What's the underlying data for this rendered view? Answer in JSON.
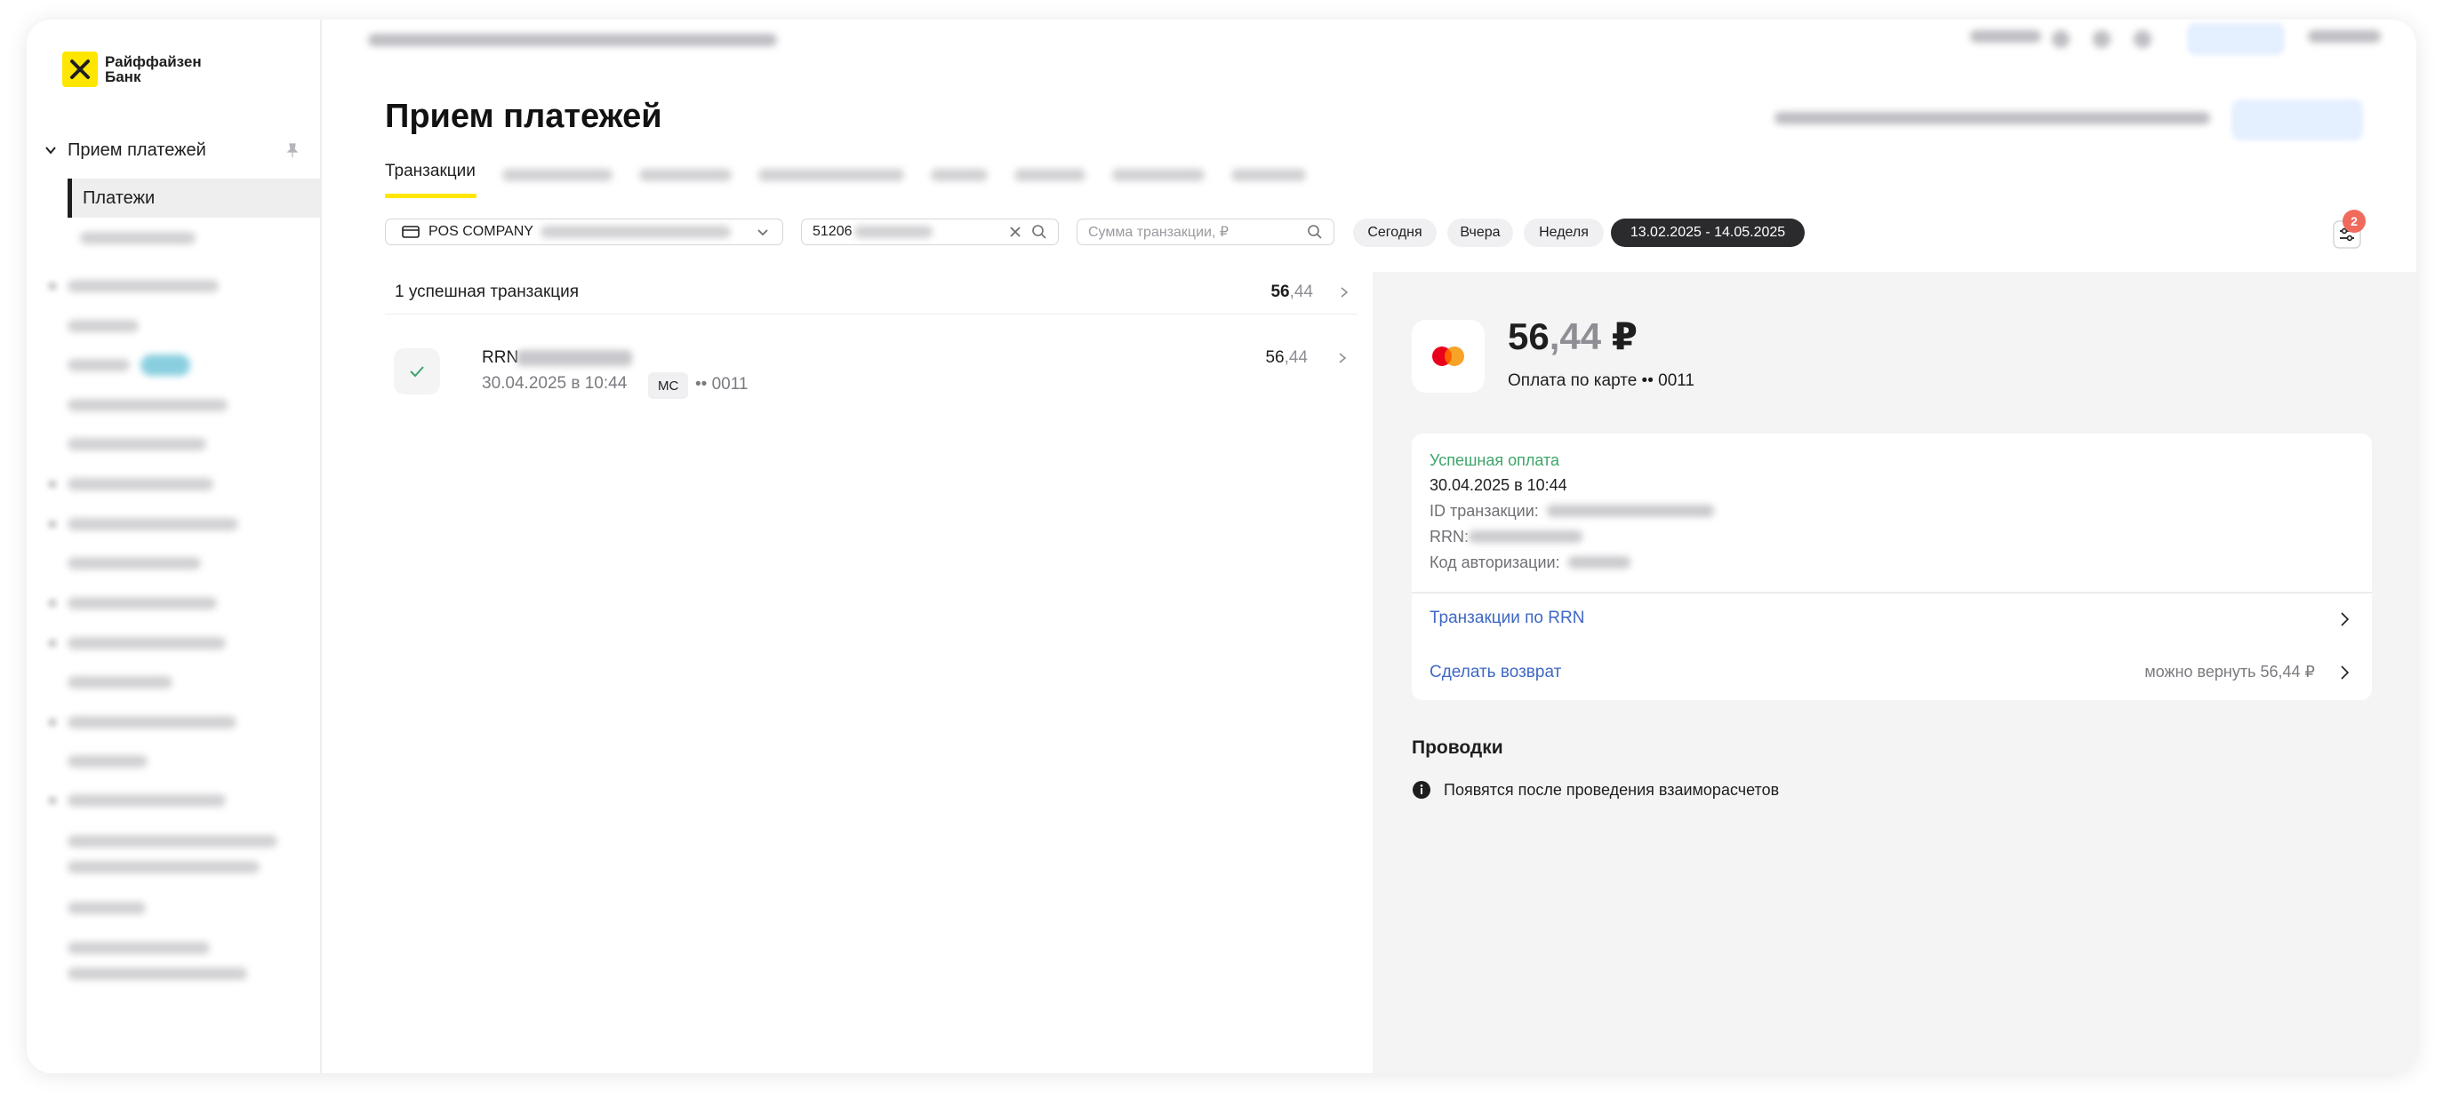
{
  "logo": {
    "line1": "Райффайзен",
    "line2": "Банк"
  },
  "sidebar": {
    "section_label": "Прием платежей",
    "active_item": "Платежи"
  },
  "page": {
    "title": "Прием платежей"
  },
  "tabs": {
    "active": "Транзакции"
  },
  "filters": {
    "terminal": "POS COMPANY",
    "search_value": "51206",
    "amount_placeholder": "Сумма транзакции, ₽"
  },
  "period_chips": {
    "today": "Сегодня",
    "yesterday": "Вчера",
    "week": "Неделя",
    "range": "13.02.2025 - 14.05.2025"
  },
  "settings_badge": "2",
  "summary": {
    "label": "1 успешная транзакция",
    "amount_int": "56",
    "amount_frac": ",44"
  },
  "transaction": {
    "rrn_label": "RRN",
    "date": "30.04.2025 в 10:44",
    "card_type": "MC",
    "card_mask": "•• 0011",
    "amount_int": "56",
    "amount_frac": ",44"
  },
  "detail": {
    "amount_int": "56",
    "amount_frac": ",44",
    "currency": "₽",
    "description": "Оплата по карте •• 0011",
    "status": "Успешная оплата",
    "datetime": "30.04.2025 в 10:44",
    "id_label": "ID транзакции:",
    "rrn_label": "RRN:",
    "auth_label": "Код авторизации:",
    "rrn_link": "Транзакции по RRN",
    "refund_link": "Сделать возврат",
    "refund_note": "можно вернуть 56,44 ₽",
    "postings_title": "Проводки",
    "postings_note": "Появятся после проведения взаиморасчетов"
  },
  "colors": {
    "brand_yellow": "#fee600",
    "success_green": "#3ea56a",
    "link_blue": "#3e68c4",
    "badge_red": "#f06b5e",
    "active_chip": "#2b2b2e"
  },
  "icons": [
    "raiffeisen-logo-icon",
    "chevron-down-icon",
    "pin-icon",
    "terminal-icon",
    "clear-icon",
    "search-icon",
    "filter-settings-icon",
    "check-icon",
    "chevron-right-icon",
    "mastercard-icon",
    "info-icon"
  ]
}
